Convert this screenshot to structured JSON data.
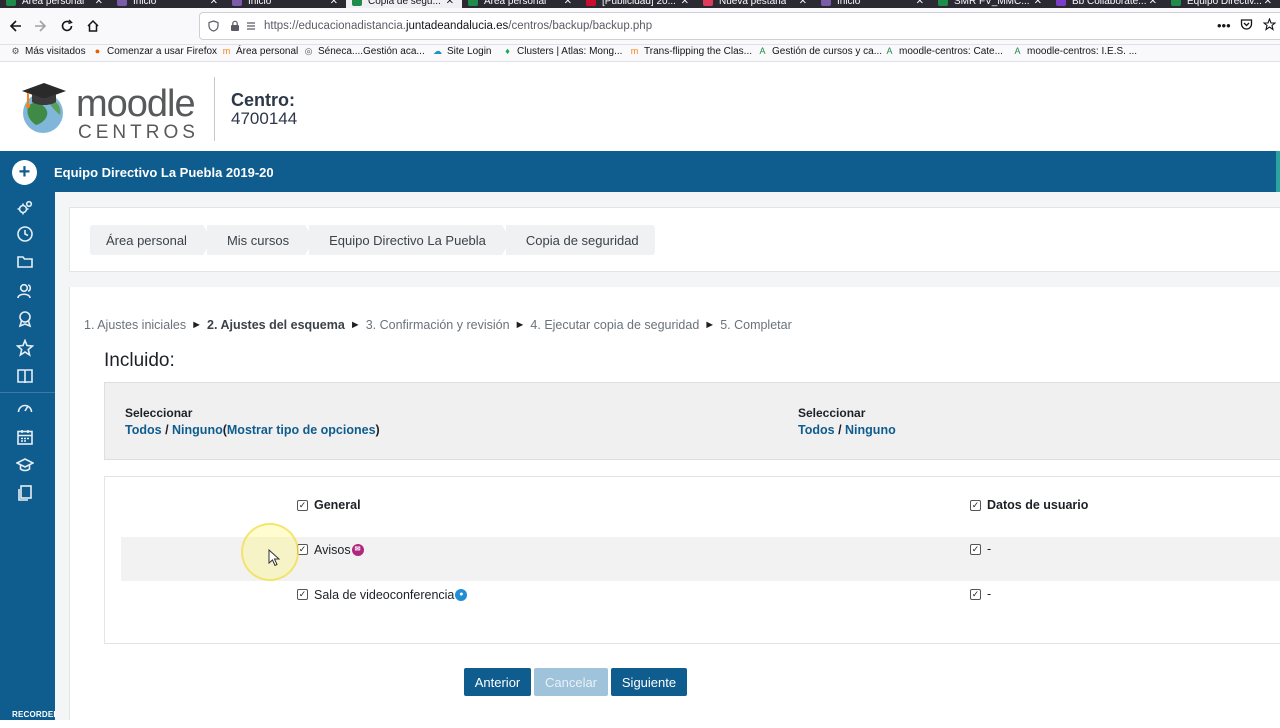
{
  "browser": {
    "tabs": [
      {
        "label": "Área personal",
        "color": "#1e8c4a",
        "active": false
      },
      {
        "label": "Inicio",
        "color": "#7a5ca8",
        "active": false
      },
      {
        "label": "Inicio",
        "color": "#7a5ca8",
        "active": false
      },
      {
        "label": "Copia de segu...",
        "color": "#1e8c4a",
        "active": true
      },
      {
        "label": "Área personal",
        "color": "#1e8c4a",
        "active": false
      },
      {
        "label": "[Publicidad] 20...",
        "color": "#c8102e",
        "active": false
      },
      {
        "label": "Nueva pestaña",
        "color": "#e03a5c",
        "active": false
      },
      {
        "label": "Inicio",
        "color": "#7a5ca8",
        "active": false
      },
      {
        "label": "SMR FV_MMC...",
        "color": "#1e8c4a",
        "active": false
      },
      {
        "label": "Bb Collaborate...",
        "color": "#7d3cc8",
        "active": false
      },
      {
        "label": "Equipo Directiv...",
        "color": "#1e8c4a",
        "active": false
      }
    ],
    "url_prefix": "https://educacionadistancia.",
    "url_domain": "juntadeandalucia.es",
    "url_path": "/centros/backup/backup.php",
    "bookmarks": [
      {
        "label": "Más visitados",
        "icon": "gear-icon",
        "color": "#555555"
      },
      {
        "label": "Comenzar a usar Firefox",
        "icon": "firefox-icon",
        "color": "#e66000"
      },
      {
        "label": "Área personal",
        "icon": "moodle-icon",
        "color": "#f98012"
      },
      {
        "label": "Séneca....Gestión aca...",
        "icon": "globe-icon",
        "color": "#555555"
      },
      {
        "label": "Site Login",
        "icon": "cloud-icon",
        "color": "#1798c1"
      },
      {
        "label": "Clusters | Atlas: Mong...",
        "icon": "leaf-icon",
        "color": "#13aa52"
      },
      {
        "label": "Trans-flipping the Clas...",
        "icon": "moodle-icon",
        "color": "#f98012"
      },
      {
        "label": "Gestión de cursos y ca...",
        "icon": "andalucia-icon",
        "color": "#1e8c4a"
      },
      {
        "label": "moodle-centros: Cate...",
        "icon": "andalucia-icon",
        "color": "#1e8c4a"
      },
      {
        "label": "moodle-centros: I.E.S. ...",
        "icon": "andalucia-icon",
        "color": "#1e8c4a"
      }
    ]
  },
  "header": {
    "logo_word": "moodle",
    "logo_sub": "CENTROS",
    "centro_label": "Centro:",
    "centro_code": "4700144",
    "course_name": "Equipo Directivo La Puebla 2019-20"
  },
  "sidebar": {
    "items": [
      {
        "name": "sidebar-item-settings",
        "icon": "gears-icon"
      },
      {
        "name": "sidebar-item-recent",
        "icon": "clock-icon"
      },
      {
        "name": "sidebar-item-files",
        "icon": "folder-icon"
      },
      {
        "name": "sidebar-item-participants",
        "icon": "users-icon"
      },
      {
        "name": "sidebar-item-badges",
        "icon": "badge-icon"
      },
      {
        "name": "sidebar-item-competencies",
        "icon": "star-icon"
      },
      {
        "name": "sidebar-item-grades",
        "icon": "book-icon"
      },
      {
        "name": "sidebar-item-dashboard",
        "icon": "dashboard-icon"
      },
      {
        "name": "sidebar-item-calendar",
        "icon": "calendar-icon"
      },
      {
        "name": "sidebar-item-courses",
        "icon": "graduation-cap-icon"
      },
      {
        "name": "sidebar-item-content-bank",
        "icon": "copy-icon"
      }
    ],
    "recorded_text": "RECORDED WITH"
  },
  "breadcrumb": [
    "Área personal",
    "Mis cursos",
    "Equipo Directivo La Puebla",
    "Copia de seguridad"
  ],
  "steps": [
    {
      "label": "1. Ajustes iniciales",
      "current": false
    },
    {
      "label": "2. Ajustes del esquema",
      "current": true
    },
    {
      "label": "3. Confirmación y revisión",
      "current": false
    },
    {
      "label": "4. Ejecutar copia de seguridad",
      "current": false
    },
    {
      "label": "5. Completar",
      "current": false
    }
  ],
  "step_arrow": "►",
  "included_heading": "Incluido:",
  "select": {
    "left_title": "Seleccionar",
    "all": "Todos",
    "separator": "/",
    "none": "Ninguno",
    "open_paren": "(",
    "show_types": "Mostrar tipo de opciones",
    "close_paren": ")",
    "right_title": "Seleccionar",
    "right_all": "Todos",
    "right_none": "Ninguno"
  },
  "items": [
    {
      "label": "General",
      "bold": true,
      "user_data": "Datos de usuario",
      "user_bold": true,
      "badge": ""
    },
    {
      "label": "Avisos",
      "bold": false,
      "user_data": "-",
      "user_bold": false,
      "badge": "#b0287d"
    },
    {
      "label": "Sala de videoconferencia",
      "bold": false,
      "user_data": "-",
      "user_bold": false,
      "badge": "#1f8ed6"
    }
  ],
  "buttons": {
    "previous": "Anterior",
    "cancel": "Cancelar",
    "next": "Siguiente"
  }
}
